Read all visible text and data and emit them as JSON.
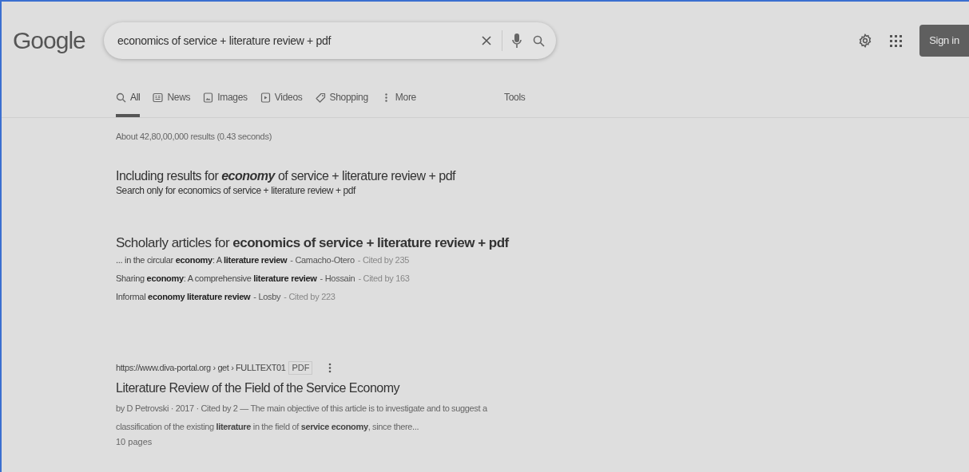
{
  "logo": "Google",
  "search": {
    "value": "economics of service + literature review + pdf"
  },
  "header_actions": {
    "sign_in": "Sign in"
  },
  "tabs": [
    {
      "label": "All",
      "kind": "search",
      "selected": true
    },
    {
      "label": "News",
      "kind": "news",
      "selected": false
    },
    {
      "label": "Images",
      "kind": "image",
      "selected": false
    },
    {
      "label": "Videos",
      "kind": "video",
      "selected": false
    },
    {
      "label": "Shopping",
      "kind": "tag",
      "selected": false
    },
    {
      "label": "More",
      "kind": "dots",
      "selected": false
    }
  ],
  "tools": "Tools",
  "result_stats": "About 42,80,00,000 results (0.43 seconds)",
  "spelling": {
    "including": "Including results for **economy** of service + literature review + pdf",
    "search_only": "Search only for economics of service + literature review + pdf"
  },
  "scholarly": {
    "heading": "Scholarly articles for **economics of service + literature review + pdf**",
    "articles": [
      {
        "title": "... in the circular **economy**: A **literature review**",
        "author": "- Camacho-Otero",
        "cited": "- Cited by 235"
      },
      {
        "title": "Sharing **economy**: A comprehensive **literature review**",
        "author": "- Hossain",
        "cited": "- Cited by 163"
      },
      {
        "title": "Informal **economy literature review**",
        "author": "- Losby",
        "cited": "- Cited by 223"
      }
    ]
  },
  "results": [
    {
      "url": "https://www.diva-portal.org › get › FULLTEXT01",
      "badge": "PDF",
      "title": "Literature Review of the Field of the Service Economy",
      "snippet": "by D Petrovski · 2017 · Cited by 2 — The main objective of this article is to investigate and to suggest a classification of the existing **literature** in the field of **service economy**, since there...",
      "pages": "10 pages"
    }
  ]
}
